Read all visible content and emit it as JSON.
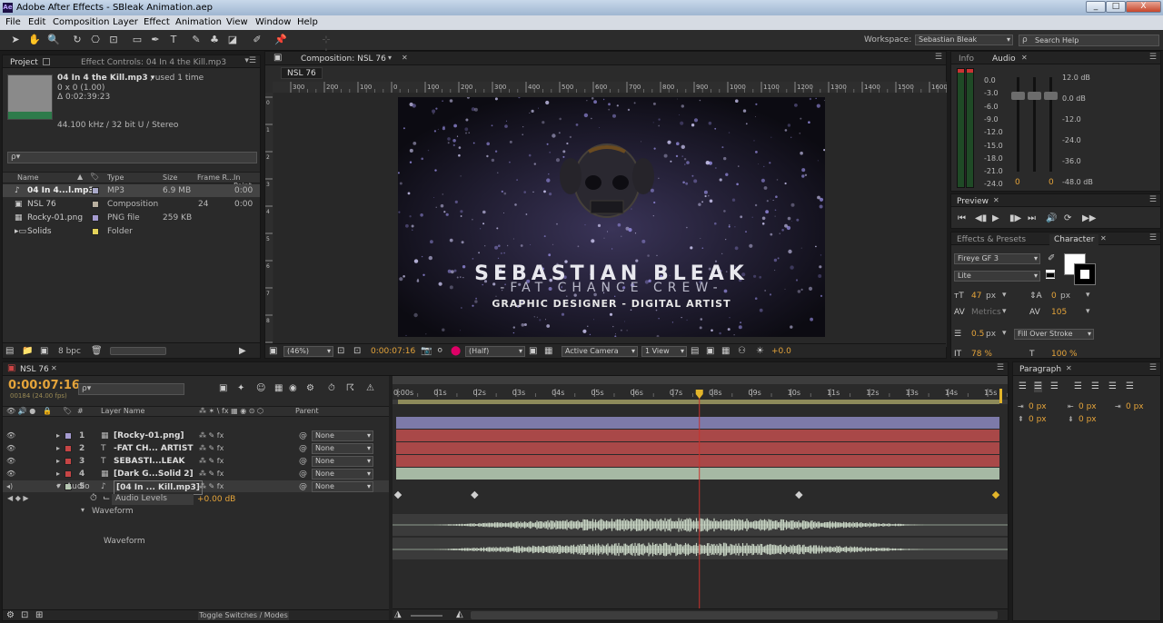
{
  "window": {
    "title": "Adobe After Effects - SBleak Animation.aep",
    "app_icon": "Ae",
    "min_label": "_",
    "max_label": "□",
    "close_label": "X"
  },
  "menu": [
    "File",
    "Edit",
    "Composition",
    "Layer",
    "Effect",
    "Animation",
    "View",
    "Window",
    "Help"
  ],
  "toolbar": {
    "tools": [
      "selection-tool",
      "hand-tool",
      "zoom-tool",
      "rotate-tool",
      "camera-tool",
      "pan-behind-tool",
      "rectangle-tool",
      "pen-tool",
      "type-tool",
      "brush-tool",
      "clone-stamp-tool",
      "eraser-tool",
      "roto-brush-tool",
      "puppet-pin-tool"
    ],
    "workspace_label": "Workspace:",
    "workspace_value": "Sebastian Bleak",
    "search_placeholder": "Search Help"
  },
  "project": {
    "tab_project": "Project",
    "tab_effects": "Effect Controls: 04 In 4 the Kill.mp3",
    "selected_name": "04 In 4 the Kill.mp3 ▾",
    "used": ", used 1 time",
    "dims": "0 x 0 (1.00)",
    "duration": "Δ 0:02:39:23",
    "audio": "44.100 kHz / 32 bit U / Stereo",
    "search_placeholder": "ρ▾",
    "columns": [
      "Name",
      "Type",
      "Size",
      "Frame R...",
      "In Point"
    ],
    "items": [
      {
        "name": "04 In 4...l.mp3",
        "type": "MP3",
        "size": "6.9 MB",
        "rate": "",
        "in": "0:00",
        "color": "#a9a9c9",
        "icon": "audio-file-icon"
      },
      {
        "name": "NSL 76",
        "type": "Composition",
        "size": "",
        "rate": "24",
        "in": "0:00",
        "color": "#b9b0a0",
        "icon": "composition-icon"
      },
      {
        "name": "Rocky-01.png",
        "type": "PNG file",
        "size": "259 KB",
        "rate": "",
        "in": "",
        "color": "#a59bd0",
        "icon": "image-file-icon"
      },
      {
        "name": "Solids",
        "type": "Folder",
        "size": "",
        "rate": "",
        "in": "",
        "color": "#e4d35a",
        "icon": "folder-icon"
      }
    ],
    "bpc": "8 bpc"
  },
  "composition": {
    "tab": "Composition: NSL 76",
    "subtab": "NSL 76",
    "ruler_ticks": [
      "300",
      "200",
      "100",
      "0",
      "100",
      "200",
      "300",
      "400",
      "500",
      "600",
      "700",
      "800",
      "900",
      "1000",
      "1100",
      "1200",
      "1300",
      "1400",
      "1500",
      "1600"
    ],
    "vruler_ticks": [
      "0",
      "1",
      "2",
      "3",
      "4",
      "5",
      "6",
      "7",
      "8",
      "9"
    ],
    "title": "SEBASTIAN BLEAK",
    "crew": "-FAT CHANCE CREW-",
    "subtitle": "GRAPHIC DESIGNER - DIGITAL ARTIST",
    "zoom": "(46%)",
    "time": "0:00:07:16",
    "resolution": "(Half)",
    "camera": "Active Camera",
    "views": "1 View",
    "exposure": "+0.0"
  },
  "info": {
    "tab_info": "Info",
    "tab_audio": "Audio",
    "left_scale": [
      "0.0",
      "-3.0",
      "-6.0",
      "-9.0",
      "-12.0",
      "-15.0",
      "-18.0",
      "-21.0",
      "-24.0"
    ],
    "right_scale": [
      "12.0 dB",
      "0.0 dB",
      "-12.0",
      "-24.0",
      "-36.0",
      "-48.0 dB"
    ],
    "vals": [
      "0",
      "0"
    ]
  },
  "preview": {
    "tab": "Preview",
    "controls": [
      "first-frame-icon",
      "prev-frame-icon",
      "play-icon",
      "next-frame-icon",
      "last-frame-icon",
      "audio-icon",
      "loop-icon",
      "ram-preview-icon"
    ]
  },
  "character": {
    "tab_effects": "Effects & Presets",
    "tab_char": "Character",
    "font": "Fireye GF 3",
    "style": "Lite",
    "size": "47",
    "size_unit": "px",
    "leading": "0",
    "leading_unit": "px",
    "kerning": "Metrics",
    "tracking": "105",
    "stroke": "0.5",
    "stroke_unit": "px",
    "stroke_mode": "Fill Over Stroke",
    "vscale": "78 %",
    "hscale": "100 %"
  },
  "timeline": {
    "tab": "NSL 76",
    "time": "0:00:07:16",
    "frames": "00184 (24.00 fps)",
    "search_placeholder": "ρ▾",
    "col_layer": "Layer Name",
    "col_parent": "Parent",
    "time_labels": [
      "0:00s",
      "01s",
      "02s",
      "03s",
      "04s",
      "05s",
      "06s",
      "07s",
      "08s",
      "09s",
      "10s",
      "11s",
      "12s",
      "13s",
      "14s",
      "15s"
    ],
    "layers": [
      {
        "num": "1",
        "name": "[Rocky-01.png]",
        "label": "#a59bd0",
        "parent": "None",
        "bar": "#7d7aa9"
      },
      {
        "num": "2",
        "name": "-FAT CH... ARTIST",
        "label": "#c64545",
        "parent": "None",
        "bar": "#a94848"
      },
      {
        "num": "3",
        "name": "SEBASTI...LEAK",
        "label": "#c64545",
        "parent": "None",
        "bar": "#a94848"
      },
      {
        "num": "4",
        "name": "[Dark G...Solid 2]",
        "label": "#c64545",
        "parent": "None",
        "bar": "#a94848"
      },
      {
        "num": "5",
        "name": "[04 In ... Kill.mp3]",
        "label": "#b5ccb0",
        "parent": "None",
        "bar": "#a6b9a4"
      }
    ],
    "audio_group": "Audio",
    "audio_levels_label": "Audio Levels",
    "audio_levels_value": "+0.00 dB",
    "waveform_group": "Waveform",
    "waveform_label": "Waveform",
    "toggle": "Toggle Switches / Modes",
    "playhead_seconds": 7.667,
    "duration_seconds": 15.3
  },
  "paragraph": {
    "tab": "Paragraph",
    "indent_vals": [
      "0 px",
      "0 px",
      "0 px",
      "0 px",
      "0 px"
    ]
  }
}
